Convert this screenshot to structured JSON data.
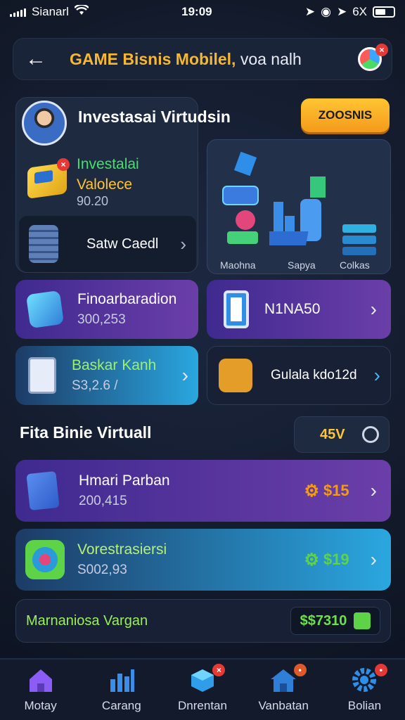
{
  "status_bar": {
    "carrier": "Sianarl",
    "time": "19:09",
    "right_text": "6X"
  },
  "header": {
    "title_yellow": "GAME Bisnis Mobilel,",
    "title_white": "voa nalh"
  },
  "profile": {
    "name": "Investasai Virtudsin",
    "action_label": "ZOOSNIS"
  },
  "investment": {
    "title_green": "Investalai",
    "title_yellow": "Valolece",
    "value": "90.20"
  },
  "coin_row": {
    "label": "Satw Caedl"
  },
  "tiles": [
    {
      "label": "Maohna",
      "icon": "robot-icon"
    },
    {
      "label": "Sapya",
      "icon": "chart-bars-icon"
    },
    {
      "label": "Colkas",
      "icon": "server-stack-icon"
    }
  ],
  "cards": {
    "finance": {
      "title": "Finoarbaradion",
      "value": "300,253",
      "icon": "cube-icon"
    },
    "phone": {
      "title": "N1NA50",
      "icon": "phone-icon"
    },
    "basket": {
      "title": "Baskar Kanh",
      "value": "S3,2.6 /",
      "icon": "tablet-icon"
    },
    "guide": {
      "title": "Gulala kdo12d",
      "icon": "refresh-icon"
    }
  },
  "section": {
    "title": "Fita Binie Virtuall",
    "toggle_label": "45V"
  },
  "items": [
    {
      "title": "Hmari Parban",
      "value": "200,415",
      "price": "$15",
      "icon": "document-icon",
      "color": "#f39c12"
    },
    {
      "title": "Vorestrasiersi",
      "value": "S002,93",
      "price": "$19",
      "icon": "compass-icon",
      "color": "#5fd348"
    }
  ],
  "footer": {
    "label": "Marnaniosa Vargan",
    "value": "$$7310"
  },
  "tabs": [
    {
      "label": "Motay",
      "icon": "home-icon"
    },
    {
      "label": "Carang",
      "icon": "bar-chart-icon"
    },
    {
      "label": "Dnrentan",
      "icon": "box-icon"
    },
    {
      "label": "Vanbatan",
      "icon": "house-icon"
    },
    {
      "label": "Bolian",
      "icon": "gear-icon"
    }
  ],
  "colors": {
    "accent_yellow": "#f7b733",
    "accent_green": "#45e06a",
    "purple": "#5b36a0",
    "blue": "#2aa7e0"
  }
}
